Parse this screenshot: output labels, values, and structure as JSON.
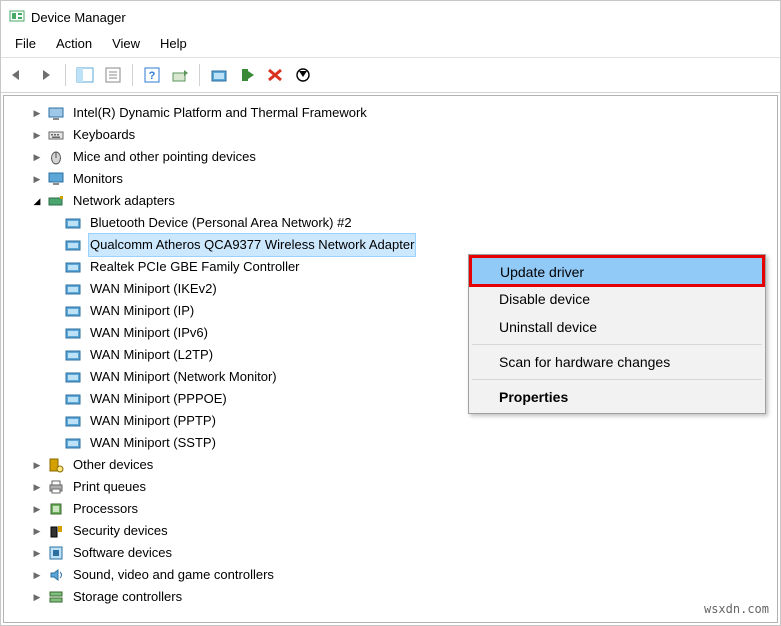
{
  "title": "Device Manager",
  "menus": {
    "file": "File",
    "action": "Action",
    "view": "View",
    "help": "Help"
  },
  "tree": {
    "items": [
      {
        "label": "Intel(R) Dynamic Platform and Thermal Framework",
        "expandable": true,
        "open": false,
        "icon": "platform"
      },
      {
        "label": "Keyboards",
        "expandable": true,
        "open": false,
        "icon": "keyboard"
      },
      {
        "label": "Mice and other pointing devices",
        "expandable": true,
        "open": false,
        "icon": "mouse"
      },
      {
        "label": "Monitors",
        "expandable": true,
        "open": false,
        "icon": "monitor"
      },
      {
        "label": "Network adapters",
        "expandable": true,
        "open": true,
        "icon": "netadapter",
        "children": [
          {
            "label": "Bluetooth Device (Personal Area Network) #2",
            "icon": "netcard"
          },
          {
            "label": "Qualcomm Atheros QCA9377 Wireless Network Adapter",
            "icon": "netcard",
            "selected": true
          },
          {
            "label": "Realtek PCIe GBE Family Controller",
            "icon": "netcard"
          },
          {
            "label": "WAN Miniport (IKEv2)",
            "icon": "netcard"
          },
          {
            "label": "WAN Miniport (IP)",
            "icon": "netcard"
          },
          {
            "label": "WAN Miniport (IPv6)",
            "icon": "netcard"
          },
          {
            "label": "WAN Miniport (L2TP)",
            "icon": "netcard"
          },
          {
            "label": "WAN Miniport (Network Monitor)",
            "icon": "netcard"
          },
          {
            "label": "WAN Miniport (PPPOE)",
            "icon": "netcard"
          },
          {
            "label": "WAN Miniport (PPTP)",
            "icon": "netcard"
          },
          {
            "label": "WAN Miniport (SSTP)",
            "icon": "netcard"
          }
        ]
      },
      {
        "label": "Other devices",
        "expandable": true,
        "open": false,
        "icon": "other"
      },
      {
        "label": "Print queues",
        "expandable": true,
        "open": false,
        "icon": "printer"
      },
      {
        "label": "Processors",
        "expandable": true,
        "open": false,
        "icon": "cpu"
      },
      {
        "label": "Security devices",
        "expandable": true,
        "open": false,
        "icon": "security"
      },
      {
        "label": "Software devices",
        "expandable": true,
        "open": false,
        "icon": "software"
      },
      {
        "label": "Sound, video and game controllers",
        "expandable": true,
        "open": false,
        "icon": "sound"
      },
      {
        "label": "Storage controllers",
        "expandable": true,
        "open": false,
        "icon": "storage"
      }
    ]
  },
  "context_menu": {
    "update": "Update driver",
    "disable": "Disable device",
    "uninstall": "Uninstall device",
    "scan": "Scan for hardware changes",
    "properties": "Properties"
  },
  "watermark": "wsxdn.com"
}
